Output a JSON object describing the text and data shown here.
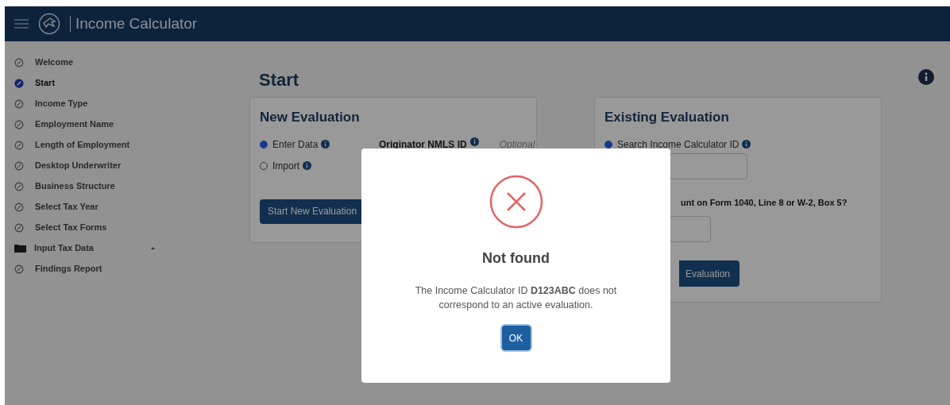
{
  "header": {
    "title": "Income Calculator"
  },
  "sidebar": {
    "items": [
      {
        "label": "Welcome",
        "kind": "step",
        "selected": false
      },
      {
        "label": "Start",
        "kind": "step",
        "selected": true
      },
      {
        "label": "Income Type",
        "kind": "step",
        "selected": false
      },
      {
        "label": "Employment Name",
        "kind": "step",
        "selected": false
      },
      {
        "label": "Length of Employment",
        "kind": "step",
        "selected": false
      },
      {
        "label": "Desktop Underwriter",
        "kind": "step",
        "selected": false
      },
      {
        "label": "Business Structure",
        "kind": "step",
        "selected": false
      },
      {
        "label": "Select Tax Year",
        "kind": "step",
        "selected": false
      },
      {
        "label": "Select Tax Forms",
        "kind": "step",
        "selected": false
      },
      {
        "label": "Input Tax Data",
        "kind": "folder",
        "selected": false
      },
      {
        "label": "Findings Report",
        "kind": "step",
        "selected": false
      }
    ]
  },
  "main": {
    "title": "Start"
  },
  "new_evaluation": {
    "title": "New Evaluation",
    "options": [
      {
        "label": "Enter Data",
        "selected": true
      },
      {
        "label": "Import",
        "selected": false
      }
    ],
    "nmls": {
      "label": "Originator NMLS ID",
      "hint": "Optional"
    },
    "button": "Start New Evaluation"
  },
  "existing_evaluation": {
    "title": "Existing Evaluation",
    "options": [
      {
        "label": "Search Income Calculator ID",
        "selected": true
      }
    ],
    "question": "unt on Form 1040, Line 8 or W-2, Box 5?",
    "button": "Evaluation"
  },
  "dialog": {
    "title": "Not found",
    "message": "The Income Calculator ID **D123ABC** does not correspond to an active evaluation.",
    "button": "OK"
  }
}
